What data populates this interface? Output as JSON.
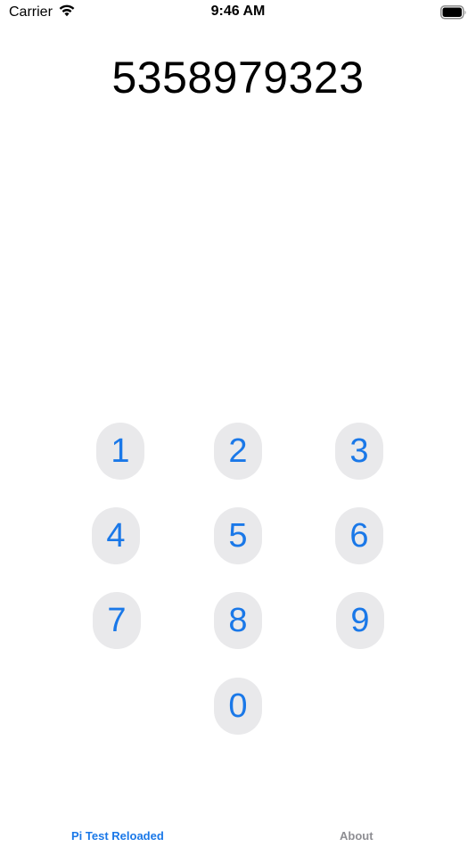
{
  "status_bar": {
    "carrier": "Carrier",
    "time": "9:46 AM",
    "wifi_icon": "wifi-icon",
    "battery_icon": "battery-icon"
  },
  "display": {
    "digits": "5358979323"
  },
  "keypad": {
    "keys": [
      "1",
      "2",
      "3",
      "4",
      "5",
      "6",
      "7",
      "8",
      "9",
      "0"
    ]
  },
  "tabs": [
    {
      "label": "Pi Test Reloaded",
      "active": true
    },
    {
      "label": "About",
      "active": false
    }
  ],
  "colors": {
    "accent": "#1a78e8",
    "key_background": "#e9e9eb",
    "inactive_tab": "#8e8e93"
  }
}
